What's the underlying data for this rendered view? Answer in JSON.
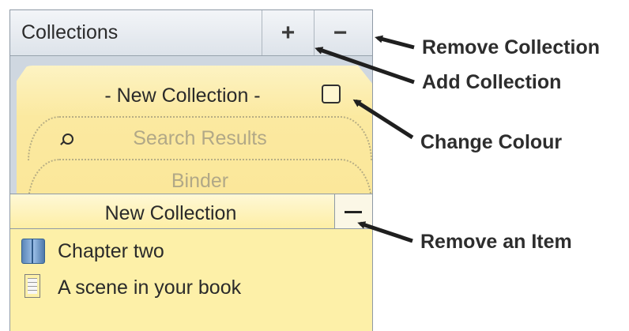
{
  "header": {
    "title": "Collections",
    "add_label": "+",
    "remove_label": "−"
  },
  "tabs": {
    "active": "- New Collection -",
    "search": "Search Results",
    "binder": "Binder"
  },
  "collection": {
    "title": "New Collection"
  },
  "items": [
    {
      "label": "Chapter two",
      "icon": "folder-icon"
    },
    {
      "label": "A scene in your book",
      "icon": "document-icon"
    }
  ],
  "callouts": {
    "remove_collection": "Remove Collection",
    "add_collection": "Add Collection",
    "change_colour": "Change Colour",
    "remove_item": "Remove an Item"
  },
  "colors": {
    "panel_bg": "#fdf0a8",
    "header_bg": "#dde3ea",
    "arrow": "#1f1f1f"
  }
}
